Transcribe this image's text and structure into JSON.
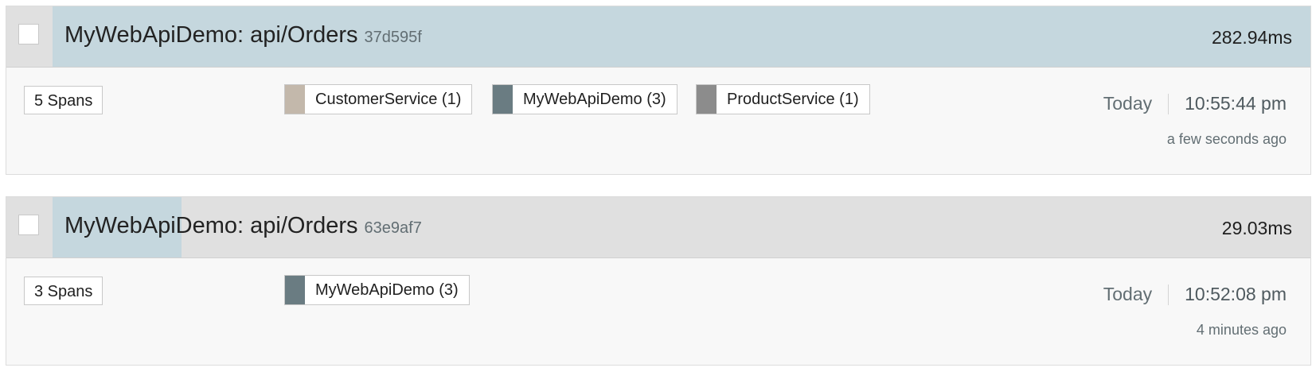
{
  "colors": {
    "duration_fill": "#c5d7de",
    "header_bg": "#e0e0e0",
    "customer_service": "#c3b8ab",
    "mywebapidemo": "#6a7c82",
    "product_service": "#8c8c8c"
  },
  "traces": [
    {
      "title": "MyWebApiDemo: api/Orders",
      "trace_id": "37d595f",
      "duration": "282.94ms",
      "duration_fraction": 1.0,
      "spans": "5 Spans",
      "services": [
        {
          "label": "CustomerService (1)",
          "color": "#c3b8ab",
          "icon": "service-swatch"
        },
        {
          "label": "MyWebApiDemo (3)",
          "color": "#6a7c82",
          "icon": "service-swatch"
        },
        {
          "label": "ProductService (1)",
          "color": "#8c8c8c",
          "icon": "service-swatch"
        }
      ],
      "day": "Today",
      "time": "10:55:44 pm",
      "relative": "a few seconds ago",
      "selected": false
    },
    {
      "title": "MyWebApiDemo: api/Orders",
      "trace_id": "63e9af7",
      "duration": "29.03ms",
      "duration_fraction": 0.1026,
      "spans": "3 Spans",
      "services": [
        {
          "label": "MyWebApiDemo (3)",
          "color": "#6a7c82",
          "icon": "service-swatch"
        }
      ],
      "day": "Today",
      "time": "10:52:08 pm",
      "relative": "4 minutes ago",
      "selected": false
    }
  ]
}
